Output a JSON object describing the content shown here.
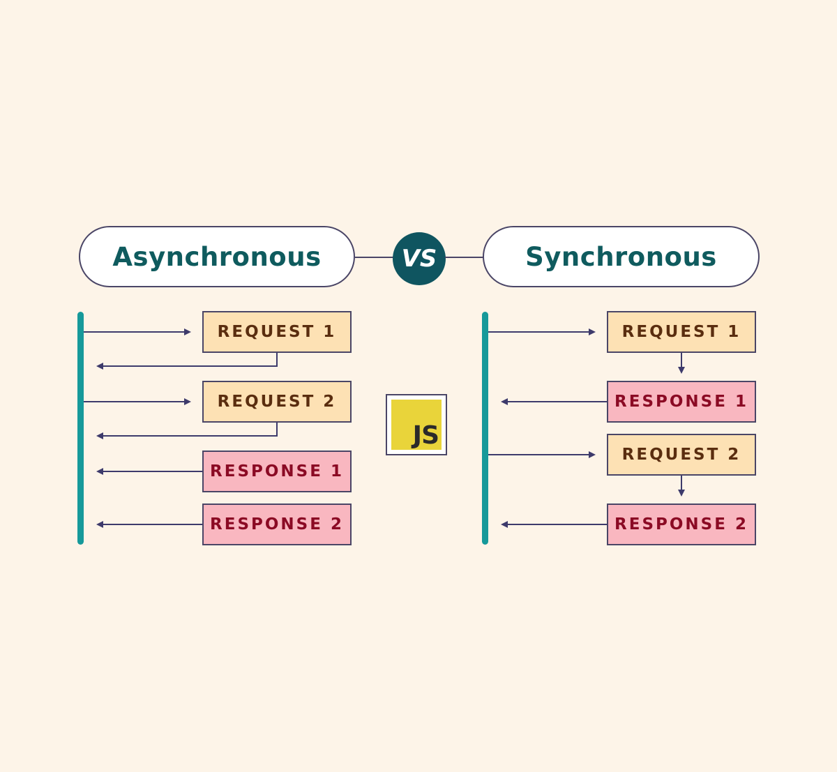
{
  "header": {
    "left_title": "Asynchronous",
    "right_title": "Synchronous",
    "vs_label": "VS"
  },
  "logo": {
    "label": "JS",
    "name": "javascript-logo"
  },
  "colors": {
    "background": "#fdf4e8",
    "title_text": "#0f5b5e",
    "vs_badge": "#0f5560",
    "timeline": "#16999a",
    "request_fill": "#fde1b4",
    "request_text": "#5a2d0f",
    "response_fill": "#f9b7c0",
    "response_text": "#8b0a24",
    "outline": "#4a4566",
    "js_yellow": "#e9d43a"
  },
  "asynchronous": {
    "boxes": [
      {
        "type": "request",
        "label": "REQUEST 1"
      },
      {
        "type": "request",
        "label": "REQUEST 2"
      },
      {
        "type": "response",
        "label": "RESPONSE 1"
      },
      {
        "type": "response",
        "label": "RESPONSE 2"
      }
    ]
  },
  "synchronous": {
    "boxes": [
      {
        "type": "request",
        "label": "REQUEST 1"
      },
      {
        "type": "response",
        "label": "RESPONSE 1"
      },
      {
        "type": "request",
        "label": "REQUEST 2"
      },
      {
        "type": "response",
        "label": "RESPONSE 2"
      }
    ]
  }
}
